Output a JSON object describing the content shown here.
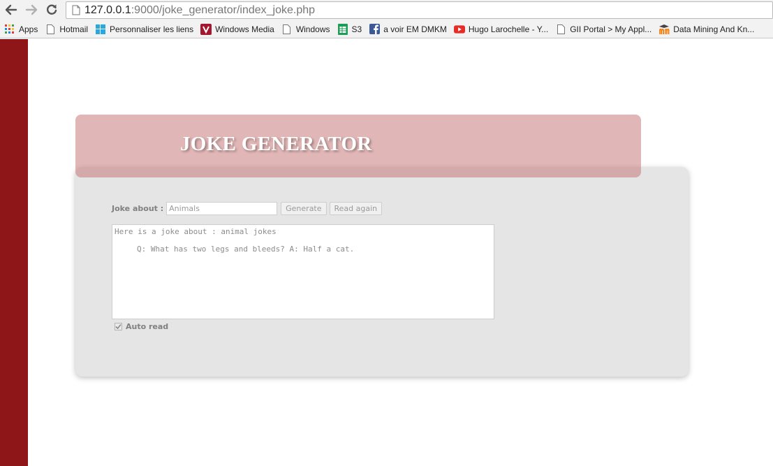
{
  "browser": {
    "url_host": "127.0.0.1",
    "url_rest": ":9000/joke_generator/index_joke.php"
  },
  "bookmarks": [
    {
      "label": "Apps",
      "icon": "apps-grid-icon"
    },
    {
      "label": "Hotmail",
      "icon": "page-icon"
    },
    {
      "label": "Personnaliser les liens",
      "icon": "windows-logo-icon"
    },
    {
      "label": "Windows Media",
      "icon": "windows-media-icon"
    },
    {
      "label": "Windows",
      "icon": "page-icon"
    },
    {
      "label": "S3",
      "icon": "sheets-icon"
    },
    {
      "label": "a voir EM DMKM",
      "icon": "facebook-icon"
    },
    {
      "label": "Hugo Larochelle - Y...",
      "icon": "youtube-icon"
    },
    {
      "label": "GII Portal > My Appl...",
      "icon": "page-icon"
    },
    {
      "label": "Data Mining And Kn...",
      "icon": "moodle-icon"
    }
  ],
  "header": {
    "title": "JOKE GENERATOR"
  },
  "form": {
    "label": "Joke about :",
    "input_value": "Animals",
    "generate_label": "Generate",
    "read_again_label": "Read again",
    "textarea_line1": "Here is a joke about : animal jokes",
    "textarea_line2": "Q: What has two legs and bleeds? A: Half a cat.",
    "auto_read_label": "Auto read",
    "auto_read_checked": true
  },
  "colors": {
    "side_stripe": "#8e1518",
    "header_bg": "#dcb6b6",
    "panel_bg": "#e5e5e5"
  }
}
